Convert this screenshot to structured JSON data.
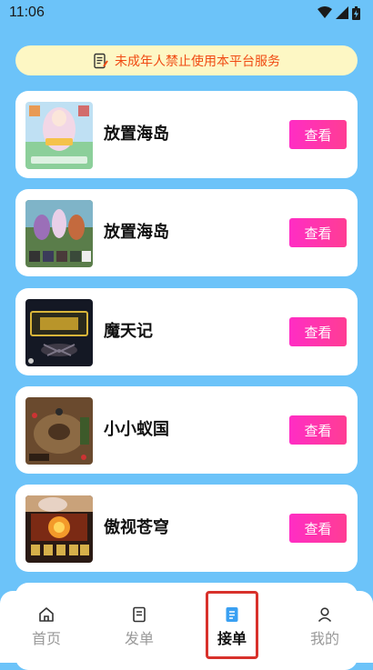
{
  "status": {
    "time": "11:06"
  },
  "notice": {
    "text": "未成年人禁止使用本平台服务"
  },
  "games": [
    {
      "name": "放置海岛",
      "button": "查看"
    },
    {
      "name": "放置海岛",
      "button": "查看"
    },
    {
      "name": "魔天记",
      "button": "查看"
    },
    {
      "name": "小小蚁国",
      "button": "查看"
    },
    {
      "name": "傲视苍穹",
      "button": "查看"
    }
  ],
  "tabs": [
    {
      "label": "首页",
      "icon": "home-icon"
    },
    {
      "label": "发单",
      "icon": "publish-icon"
    },
    {
      "label": "接单",
      "icon": "orders-icon",
      "active": true
    },
    {
      "label": "我的",
      "icon": "user-icon"
    }
  ],
  "colors": {
    "background": "#6cc3f9",
    "button_gradient": [
      "#ff2dc4",
      "#ff3d94"
    ],
    "notice_text": "#f04a12",
    "notice_bg": "#fdf7c4",
    "active_tab_icon": "#3aa0f2",
    "highlight": "#d8312b"
  }
}
